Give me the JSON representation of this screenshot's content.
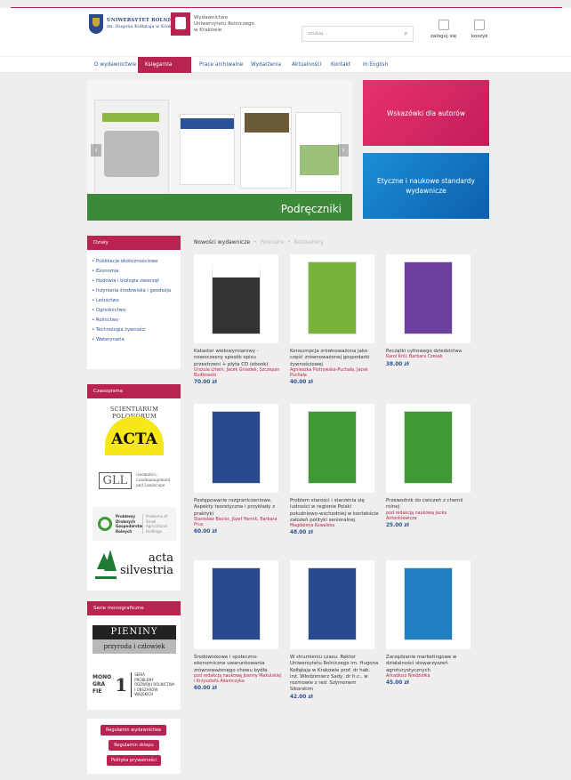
{
  "header": {
    "uni_name": "UNIWERSYTET ROLNICZY",
    "uni_sub": "im. Hugona Kołłątaja w Krakowie",
    "publisher_l1": "Wydawnictwo",
    "publisher_l2": "Uniwersytetu Rolniczego",
    "publisher_l3": "w Krakowie",
    "search_placeholder": "szukaj...",
    "login": "zaloguj się",
    "cart": "koszyk"
  },
  "nav": [
    "O wydawnictwie",
    "Księgarnia",
    "Prace archiwalne",
    "Wydarzenia",
    "Aktualności",
    "Kontakt",
    "In English"
  ],
  "slider": {
    "caption": "Podręczniki"
  },
  "promos": [
    "Wskazówki dla autorów",
    "Etyczne i naukowe standardy wydawnicze"
  ],
  "sidebar": {
    "dzialy_title": "Działy",
    "categories": [
      "Publikacje okolicznościowe",
      "Ekonomia",
      "Hodowla i biologia zwierząt",
      "Inżynieria środowiska i geodezja",
      "Leśnictwo",
      "Ogrodnictwo",
      "Rolnictwo",
      "Technologia żywności",
      "Weterynaria"
    ],
    "journals_title": "Czasopisma",
    "series_title": "Serie monograficzne",
    "buttons": [
      "Regulamin wydawnictwa",
      "Regulamin sklepu",
      "Polityka prywatności"
    ]
  },
  "tabs": [
    "Nowości wydawnicze",
    "Polecane",
    "Bestsellery"
  ],
  "products": [
    {
      "title": "Kataster wielowymiarowy - nowoczesny sposób opisu przestrzeni + płyta CD (ebook)",
      "authors": "Urszula Litwin, Jacek Gniadek, Szczepan Budkowski",
      "price": "70.00 zł",
      "color": "#333"
    },
    {
      "title": "Konsumpcja zrównoważona jako część zrównoważonej gospodarki żywnościowej",
      "authors": "Agnieszka Piotrowska-Puchała, Jacek Puchała",
      "price": "40.00 zł",
      "color": "#7ab33a"
    },
    {
      "title": "Początki cyfrowego dziedzictwa",
      "authors": "Karol Król, Barbara Czesak",
      "price": "38.00 zł",
      "color": "#6a3fa0"
    },
    {
      "title": "Postępowanie rozgraniczeniowe. Aspekty teoretyczne i przykłady z praktyki",
      "authors": "Stanisław Bacior, Józef Hernik, Barbara Prus",
      "price": "60.00 zł",
      "color": "#2a4a8f"
    },
    {
      "title": "Problem starości i starzenia się ludności w regionie Polski południowo-wschodniej w kontekście założeń polityki senioralnej",
      "authors": "Magdalena Kowalska",
      "price": "48.00 zł",
      "color": "#3f9a35"
    },
    {
      "title": "Przewodnik do ćwiczeń z chemii rolnej",
      "authors": "pod redakcją naukową Jacka Antonkiewicza",
      "price": "25.00 zł",
      "color": "#3f9a35"
    },
    {
      "title": "Środowiskowe i społeczno-ekonomiczne uwarunkowania zrównoważonego chowu bydła",
      "authors": "pod redakcją naukową Joanny Makulskiej i Krzysztofa Adamczyka",
      "price": "60.00 zł",
      "color": "#2a4a8f"
    },
    {
      "title": "W strumieniu czasu. Rektor Uniwersytetu Rolniczego im. Hugona Kołłątaja w Krakowie prof. dr hab. inż. Włodzimierz Sady, dr h.c., w rozmowie z red. Szymonem Sikorskim",
      "authors": "",
      "price": "42.00 zł",
      "color": "#2a4a8f"
    },
    {
      "title": "Zarządzanie marketingowe w działalności stowarzyszeń agroturystycznych",
      "authors": "Arkadiusz Niedziółka",
      "price": "45.00 zł",
      "color": "#1f7fc0"
    }
  ],
  "journals": {
    "acta": "ACTA",
    "scientiarum": "SCIENTIARUM POLONORUM",
    "gll": "GLL",
    "gll_sub1": "Geomatics,",
    "gll_sub2": "Landmanagement",
    "gll_sub3": "and Landscape",
    "prob_left": "Problemy Drobnych Gospodarstw Rolnych",
    "prob_right": "Problems of Small Agricultural Holdings",
    "silv1": "acta",
    "silv2": "silvestria"
  },
  "series": {
    "pieniny1": "PIENINY",
    "pieniny2": "przyroda i człowiek",
    "mono": "MONO GRA FIE",
    "mono_num": "1",
    "seria1": "SERIA",
    "seria2": "PROBLEMY",
    "seria3": "ROZWOJU ROLNICTWA",
    "seria4": "I OBSZARÓW WIEJSKICH"
  }
}
